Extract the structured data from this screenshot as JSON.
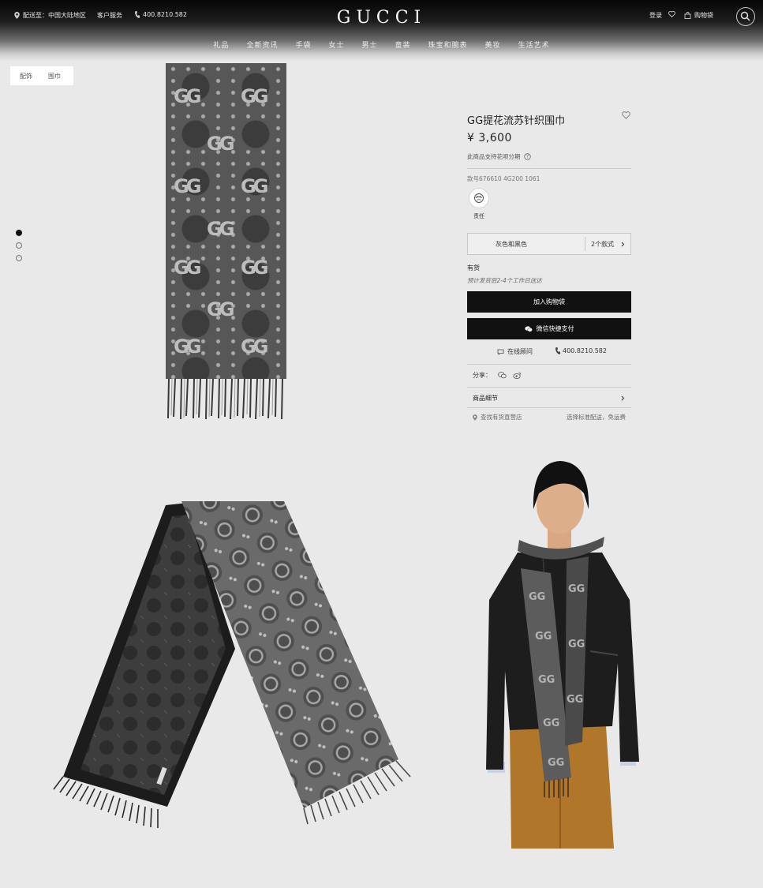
{
  "header": {
    "logo": "GUCCI",
    "delivery_label": "配送至：中国大陆地区",
    "customer_service": "客户服务",
    "phone": "400.8210.582",
    "login": "登录",
    "bag": "购物袋",
    "nav": [
      "礼品",
      "全新资讯",
      "手袋",
      "女士",
      "男士",
      "童装",
      "珠宝和腕表",
      "美妆",
      "生活艺术"
    ]
  },
  "breadcrumb": [
    "配饰",
    "围巾"
  ],
  "gallery": {
    "pages": 3,
    "current": 1
  },
  "product": {
    "title": "GG提花流苏针织围巾",
    "price": "¥ 3,600",
    "installment": "此商品支持花呗分期",
    "sku": "款号676610 4G200 1061",
    "badge_label": "责任",
    "variant_color": "灰色和黑色",
    "variant_count": "2个款式",
    "stock": "有货",
    "shipping_eta": "预计发货后2-4个工作日送达",
    "add_to_bag": "加入购物袋",
    "wechat_pay": "微信快捷支付",
    "online_consult": "在线顾问",
    "phone": "400.8210.582",
    "share_label": "分享：",
    "details_label": "商品细节",
    "find_store": "查找有货直营店",
    "free_shipping": "选择标准配送，免运费"
  },
  "colors": {
    "accent": "#111111",
    "background": "#e9e9e9"
  }
}
